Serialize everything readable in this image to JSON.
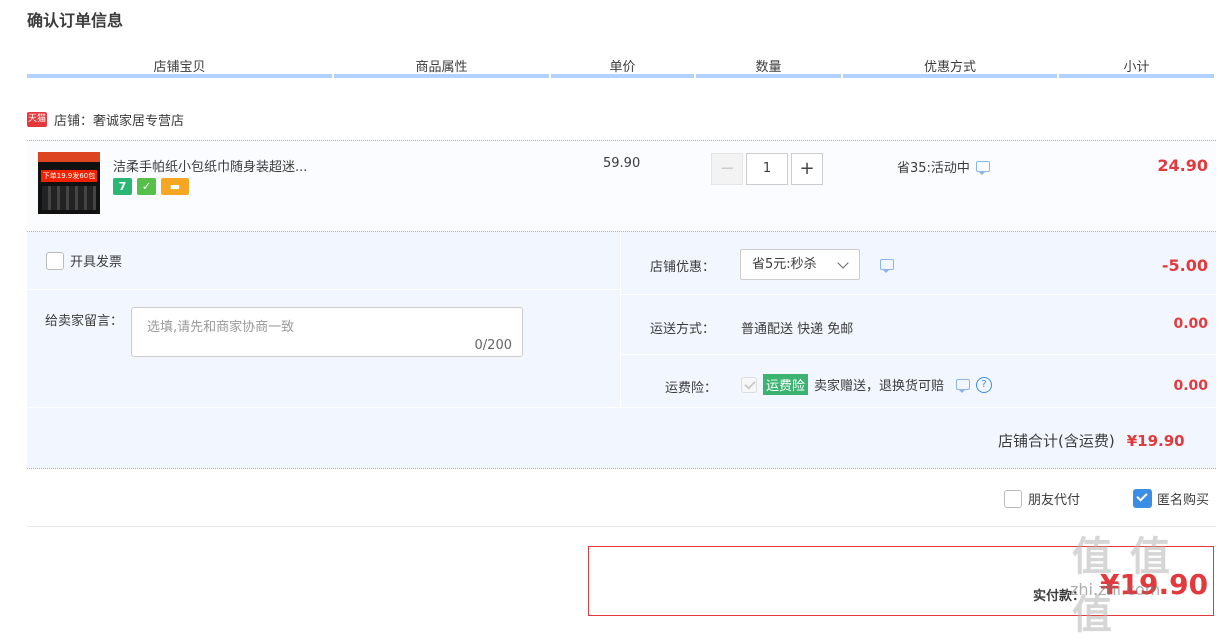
{
  "page_title": "确认订单信息",
  "columns": [
    "店铺宝贝",
    "商品属性",
    "单价",
    "数量",
    "优惠方式",
    "小计"
  ],
  "shop": {
    "tag": "天猫",
    "label": "店铺：奢诚家居专营店"
  },
  "item": {
    "name": "洁柔手帕纸小包纸巾随身装超迷...",
    "thumb_text": "下单19.9发60包",
    "badges": [
      {
        "text": "7",
        "color": "#2bb673",
        "icon": "seven-day-return-icon"
      },
      {
        "text": "✓",
        "color": "#58c04a",
        "icon": "guarantee-icon"
      },
      {
        "text": "▬",
        "color": "#f5a623",
        "icon": "card-payment-icon"
      }
    ],
    "unit_price": "59.90",
    "quantity": "1",
    "qty_minus": "−",
    "qty_plus": "+",
    "promo": "省35:活动中",
    "subtotal": "24.90"
  },
  "invoice": {
    "label": "开具发票",
    "checked": false
  },
  "message": {
    "label": "给卖家留言：",
    "placeholder": "选填,请先和商家协商一致",
    "counter": "0/200"
  },
  "shop_discount": {
    "label": "店铺优惠：",
    "selected": "省5元:秒杀",
    "amount": "-5.00"
  },
  "shipping": {
    "label": "运送方式：",
    "value": "普通配送 快递 免邮",
    "amount": "0.00"
  },
  "insurance": {
    "label": "运费险：",
    "tag": "运费险",
    "text": "卖家赠送，退换货可赔",
    "amount": "0.00"
  },
  "shop_total": {
    "label": "店铺合计(含运费)",
    "amount": "¥19.90"
  },
  "friend_pay": {
    "label": "朋友代付",
    "checked": false
  },
  "anonymous": {
    "label": "匿名购买",
    "checked": true
  },
  "payment": {
    "label": "实付款：",
    "amount": "¥19.90"
  },
  "watermark": {
    "text": "值 值 值",
    "site": "zhi.zhi.com"
  }
}
